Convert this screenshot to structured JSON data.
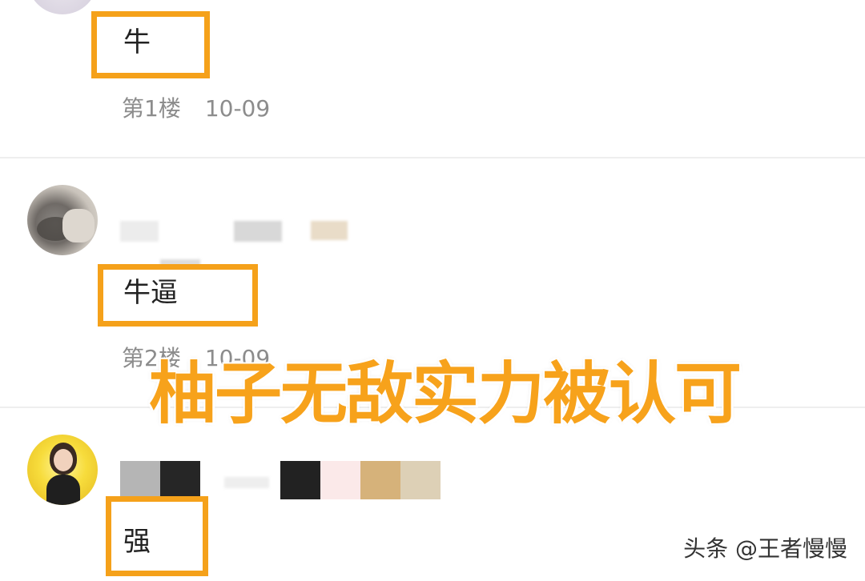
{
  "comments": [
    {
      "text": "牛",
      "floor": "第1楼",
      "date": "10-09",
      "avatar_icon": "avatar-image"
    },
    {
      "text": "牛逼",
      "floor": "第2楼",
      "date": "10-09",
      "avatar_icon": "avatar-image"
    },
    {
      "text": "强",
      "avatar_icon": "avatar-image"
    }
  ],
  "overlay_title": "柚子无敌实力被认可",
  "watermark": "头条 @王者慢慢",
  "colors": {
    "highlight_border": "#f5a11a",
    "overlay_text": "#f7a21b",
    "meta_text": "#8c8c8c",
    "divider": "#eeeeee"
  }
}
